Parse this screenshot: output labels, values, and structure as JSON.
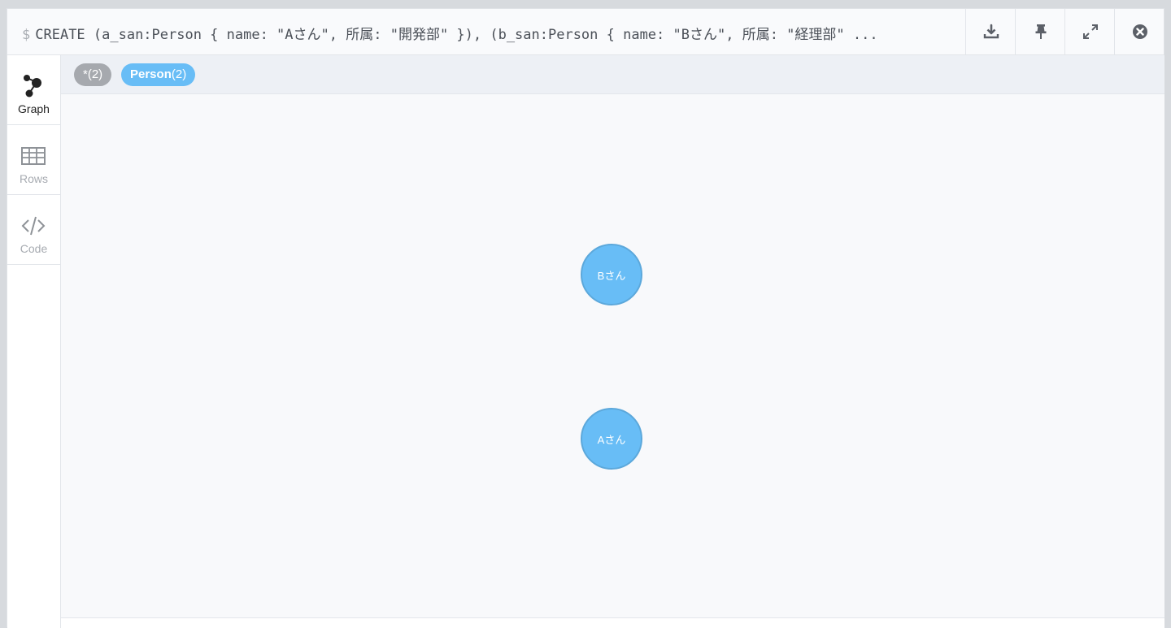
{
  "header": {
    "prompt": "$",
    "query": "CREATE (a_san:Person { name: \"Aさん\", 所属: \"開発部\" }), (b_san:Person { name: \"Bさん\", 所属: \"経理部\" ...",
    "buttons": [
      "download-icon",
      "pin-icon",
      "expand-icon",
      "close-icon"
    ]
  },
  "sidenav": {
    "items": [
      {
        "label": "Graph",
        "icon": "graph-icon",
        "active": true
      },
      {
        "label": "Rows",
        "icon": "table-icon",
        "active": false
      },
      {
        "label": "Code",
        "icon": "code-icon",
        "active": false
      }
    ]
  },
  "labels": {
    "all": {
      "text": "*",
      "count": "(2)"
    },
    "person": {
      "text": "Person",
      "count": "(2)"
    }
  },
  "graph": {
    "nodes": [
      {
        "caption": "Bさん",
        "label": "Person"
      },
      {
        "caption": "Aさん",
        "label": "Person"
      }
    ]
  },
  "colors": {
    "node_fill": "#68bdf6",
    "node_border": "#5ca8db",
    "all_pill": "#a6a9ae"
  }
}
